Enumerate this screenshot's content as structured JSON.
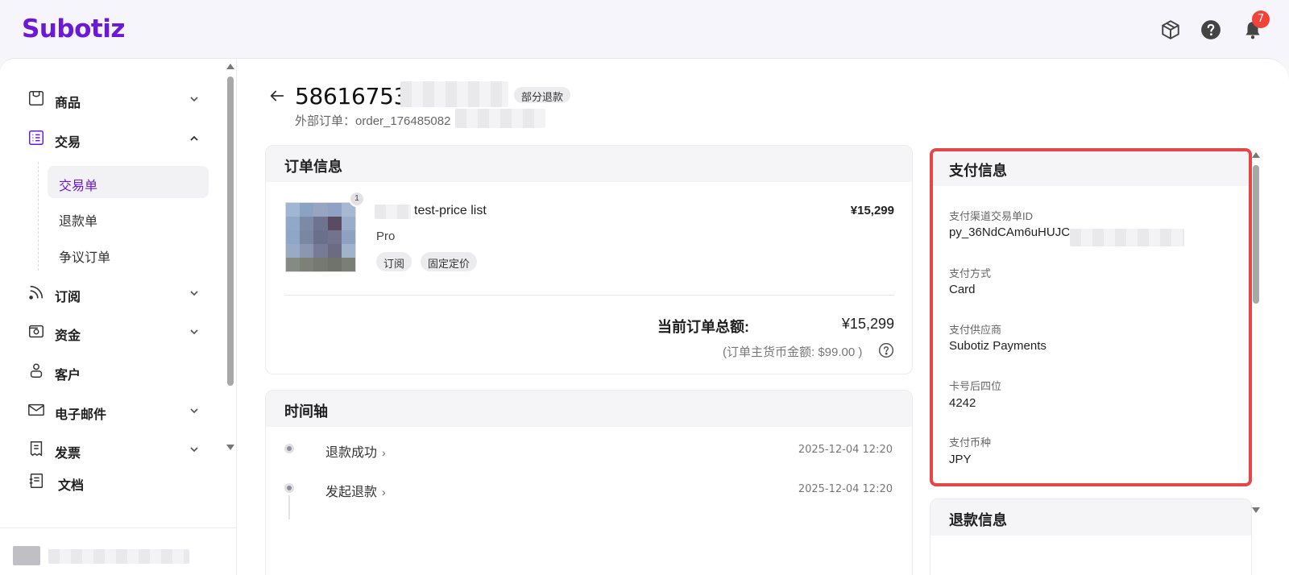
{
  "app": {
    "logo": "Subotiz",
    "notifications_count": "7"
  },
  "sidebar": {
    "items": [
      {
        "label": "商品",
        "icon": "box-icon",
        "chevron": "chevron-down-icon"
      },
      {
        "label": "交易",
        "icon": "list-icon",
        "chevron": "chevron-up-icon"
      },
      {
        "label": "订阅",
        "icon": "rss-icon",
        "chevron": "chevron-down-icon"
      },
      {
        "label": "资金",
        "icon": "wallet-icon",
        "chevron": "chevron-down-icon"
      },
      {
        "label": "客户",
        "icon": "user-icon"
      },
      {
        "label": "电子邮件",
        "icon": "mail-icon",
        "chevron": "chevron-down-icon"
      },
      {
        "label": "发票",
        "icon": "invoice-icon",
        "chevron": "chevron-down-icon"
      },
      {
        "label": "文档",
        "icon": "doc-icon"
      }
    ],
    "sub_items": [
      "交易单",
      "退款单",
      "争议订单"
    ],
    "active_sub": "交易单"
  },
  "header": {
    "order_id": "586167535",
    "status_badge": "部分退款",
    "external_label": "外部订单：",
    "external_value": "order_176485082"
  },
  "order_info": {
    "title": "订单信息",
    "quantity": "1",
    "product_name": "test-price list",
    "plan": "Pro",
    "tags": [
      "订阅",
      "固定定价"
    ],
    "price": "¥15,299",
    "total_label": "当前订单总额:",
    "total_value": "¥15,299",
    "total_sub": "(订单主货币金额: $99.00 )"
  },
  "timeline": {
    "title": "时间轴",
    "events": [
      {
        "label": "退款成功",
        "time": "2025-12-04 12:20"
      },
      {
        "label": "发起退款",
        "time": "2025-12-04 12:20"
      }
    ]
  },
  "payment_info": {
    "title": "支付信息",
    "fields": [
      {
        "label": "支付渠道交易单ID",
        "value": "py_36NdCAm6uHUJC"
      },
      {
        "label": "支付方式",
        "value": "Card"
      },
      {
        "label": "支付供应商",
        "value": "Subotiz Payments"
      },
      {
        "label": "卡号后四位",
        "value": "4242"
      },
      {
        "label": "支付币种",
        "value": "JPY"
      }
    ]
  },
  "refund_info": {
    "title": "退款信息"
  },
  "colors": {
    "brand": "#6b19d6",
    "highlight_border": "#e64646",
    "badge": "#f04438"
  }
}
